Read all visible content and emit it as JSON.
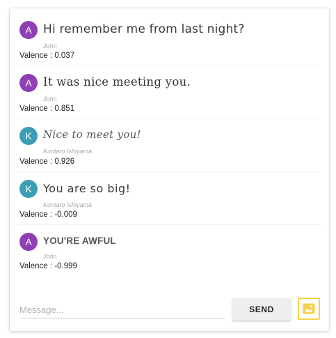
{
  "colors": {
    "avatar_purple": "#8e3fb5",
    "avatar_teal": "#3a9fb6",
    "image_button_accent": "#f5d24a"
  },
  "messages": [
    {
      "initial": "A",
      "avatar_color": "#8e3fb5",
      "text": "Hi remember me from last night?",
      "author": "John",
      "valence_label": "Valence :",
      "valence": "0.037"
    },
    {
      "initial": "A",
      "avatar_color": "#8e3fb5",
      "text": "It was nice meeting you.",
      "author": "John",
      "valence_label": "Valence :",
      "valence": "0.851"
    },
    {
      "initial": "K",
      "avatar_color": "#3a9fb6",
      "text": "Nice to meet you!",
      "author": "Kuntaro Ishiyama",
      "valence_label": "Valence :",
      "valence": "0.926"
    },
    {
      "initial": "K",
      "avatar_color": "#3a9fb6",
      "text": "You are so big!",
      "author": "Kuntaro Ishiyama",
      "valence_label": "Valence :",
      "valence": "-0.009"
    },
    {
      "initial": "A",
      "avatar_color": "#8e3fb5",
      "text": "YOU'RE AWFUL",
      "author": "John",
      "valence_label": "Valence :",
      "valence": "-0.999"
    }
  ],
  "composer": {
    "placeholder": "Message...",
    "value": "",
    "send_label": "SEND",
    "image_icon": "image-icon"
  }
}
